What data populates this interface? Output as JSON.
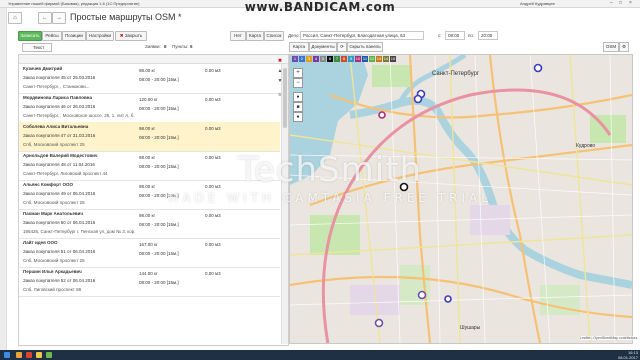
{
  "window": {
    "title": "Управление нашей фирмой (Базовая), редакция 1.6 (1С:Предприятие)",
    "user": "Андрей Кудрявцев"
  },
  "recorder_banner": "www.BANDICAM.com",
  "document": {
    "title": "Простые маршруты OSM *"
  },
  "toolbar": {
    "save_label": "Записать",
    "flights_label": "Рейсы",
    "positions_label": "Позиции",
    "settings_label": "Настройки",
    "close_label": "Закрыть"
  },
  "filters": {
    "text_label": "Текст",
    "orders_label": "Заявки:",
    "orders_count": "8",
    "points_label": "Пункты:",
    "points_count": "6",
    "mode_buttons": [
      "Нет",
      "Карта",
      "Список"
    ],
    "depot_label": "Депо:",
    "depot_value": "Россия, Санкт-Петербург, Благодатная улица, 63",
    "from_label": "с:",
    "from_time": "08:00",
    "to_label": "по:",
    "to_time": "20:00"
  },
  "orders": [
    {
      "name": "Кузичев Дмитрий",
      "order": "Заказ покупателя 45 от 25.03.2016",
      "address": "Санкт-Петербург, , Станюкови...",
      "weight": "98.00 кг",
      "time": "08:00 - 20:00 [15м.]",
      "volume": "0.00 м3",
      "highlight": false
    },
    {
      "name": "Мордвинова Лариса Павловна",
      "order": "Заказ покупателя 46 от 26.03.2016",
      "address": "Санкт-Петербург, , Московское шоссе, 25, 1, лит А, б...",
      "weight": "120.00 кг",
      "time": "08:00 - 20:00 [15м.]",
      "volume": "0.00 м3",
      "highlight": false
    },
    {
      "name": "Соболева Алиса Витальевна",
      "order": "Заказ покупателя 47 от 31.03.2016",
      "address": "Спб, Московский проспект 25",
      "weight": "98.00 кг",
      "time": "08:00 - 20:00 [15м.]",
      "volume": "0.00 м3",
      "highlight": true
    },
    {
      "name": "Арнольдов Валерий Модестович",
      "order": "Заказ покупателя 48 от 11.04.2016",
      "address": "Санкт-Петербург, Лиговский проспект 44",
      "weight": "98.00 кг",
      "time": "08:00 - 20:00 [15м.]",
      "volume": "0.00 м3",
      "highlight": false
    },
    {
      "name": "Альянс Комфорт ООО",
      "order": "Заказ покупателя 49 от 06.04.2016",
      "address": "Спб, Московский проспект 25",
      "weight": "98.00 кг",
      "time": "08:00 - 20:00 [15м.]",
      "volume": "0.00 м3",
      "highlight": false
    },
    {
      "name": "Пахман Марк Анатольевич",
      "order": "Заказ покупателя 50 от 06.04.2016",
      "address": "195426, Санкт-Петербург г, Пенская ул, дом № 3, кор...",
      "weight": "98.00 кг",
      "time": "08:00 - 20:00 [15м.]",
      "volume": "0.00 м3",
      "highlight": false
    },
    {
      "name": "Лайт идея ООО",
      "order": "Заказ покупателя 51 от 06.04.2016",
      "address": "Спб, Московский проспект 25",
      "weight": "167.00 кг",
      "time": "08:00 - 20:00 [15м.]",
      "volume": "0.00 м3",
      "highlight": false
    },
    {
      "name": "Першин Илья Аркадьевич",
      "order": "Заказ покупателя 52 от 06.04.2016",
      "address": "Спб, Лиговский проспект 88",
      "weight": "144.00 кг",
      "time": "08:00 - 20:00 [15м.]",
      "volume": "0.00 м3",
      "highlight": false
    }
  ],
  "map": {
    "tabs": [
      "Карта",
      "Документы"
    ],
    "hide_panel_label": "Скрыть панель",
    "provider": "OSM",
    "color_swatches": [
      {
        "n": "1",
        "c": "#6a4fb0"
      },
      {
        "n": "2",
        "c": "#3f6fd0"
      },
      {
        "n": "3",
        "c": "#e0a21a"
      },
      {
        "n": "4",
        "c": "#7a3c9c"
      },
      {
        "n": "5",
        "c": "#8a8a8a"
      },
      {
        "n": "6",
        "c": "#111111"
      },
      {
        "n": "7",
        "c": "#3d8b3d"
      },
      {
        "n": "8",
        "c": "#d24a2a"
      },
      {
        "n": "9",
        "c": "#2a9cc9"
      },
      {
        "n": "10",
        "c": "#b0297a"
      },
      {
        "n": "11",
        "c": "#1e5aa8"
      },
      {
        "n": "12",
        "c": "#5fb04a"
      },
      {
        "n": "13",
        "c": "#c47a1a"
      },
      {
        "n": "14",
        "c": "#7b7b3a"
      },
      {
        "n": "15",
        "c": "#444444"
      }
    ],
    "place_labels": [
      "Санкт-Петербург",
      "Кудрово",
      "Шушары"
    ],
    "attribution": "Leaflet | OpenStreetMap contributors"
  },
  "watermark": {
    "brand": "TechSmith",
    "tagline": "MADE WITH CAMTASIA FREE TRIAL"
  },
  "taskbar": {
    "time": "16:13",
    "date": "08.01.2017"
  }
}
